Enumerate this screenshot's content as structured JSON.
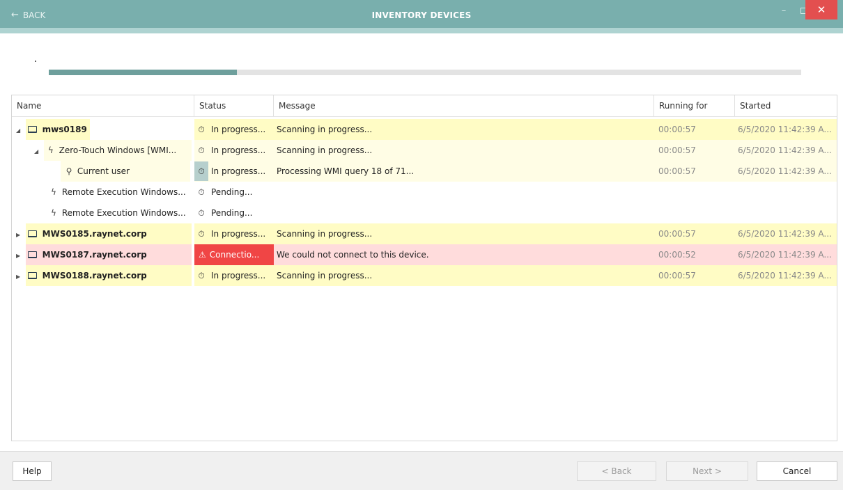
{
  "titlebar": {
    "back_label": "BACK",
    "title": "INVENTORY DEVICES",
    "minimize": "–",
    "close": "✕"
  },
  "progress": {
    "value": 0.25
  },
  "columns": [
    "Name",
    "Status",
    "Message",
    "Running for",
    "Started"
  ],
  "rows": [
    {
      "name": "mws0189",
      "status": "In progress...",
      "message": "Scanning in progress...",
      "running": "00:00:57",
      "started": "6/5/2020 11:42:39 A..."
    },
    {
      "name": "Zero-Touch Windows [WMI...",
      "status": "In progress...",
      "message": "Scanning in progress...",
      "running": "00:00:57",
      "started": "6/5/2020 11:42:39 A..."
    },
    {
      "name": "Current user",
      "status": "In progress...",
      "message": "Processing WMI query 18 of 71...",
      "running": "00:00:57",
      "started": "6/5/2020 11:42:39 A..."
    },
    {
      "name": "Remote Execution Windows...",
      "status": "Pending...",
      "message": "",
      "running": "",
      "started": ""
    },
    {
      "name": "Remote Execution Windows...",
      "status": "Pending...",
      "message": "",
      "running": "",
      "started": ""
    },
    {
      "name": "MWS0185.raynet.corp",
      "status": "In progress...",
      "message": "Scanning in progress...",
      "running": "00:00:57",
      "started": "6/5/2020 11:42:39 A..."
    },
    {
      "name": "MWS0187.raynet.corp",
      "status": "Connectio...",
      "message": "We could not connect to this device.",
      "running": "00:00:52",
      "started": "6/5/2020 11:42:39 A..."
    },
    {
      "name": "MWS0188.raynet.corp",
      "status": "In progress...",
      "message": "Scanning in progress...",
      "running": "00:00:57",
      "started": "6/5/2020 11:42:39 A..."
    }
  ],
  "footer": {
    "help": "Help",
    "back": "< Back",
    "next": "Next >",
    "cancel": "Cancel"
  },
  "colors": {
    "titlebar": "#79afad",
    "accent_strip": "#aed3d1",
    "progress_fill": "#6e9f9c",
    "row_in_progress": "#fffcc5",
    "row_error": "#ffdcdc",
    "error_badge": "#f04545",
    "close_button": "#e34f4f"
  }
}
